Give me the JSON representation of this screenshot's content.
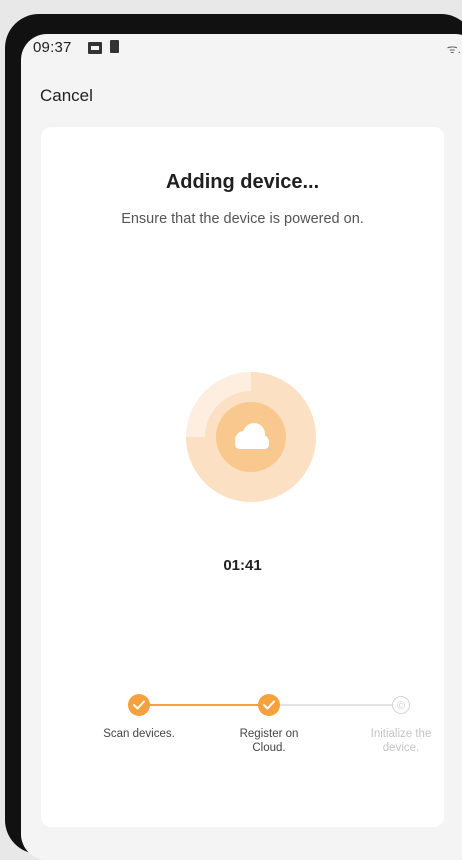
{
  "status_bar": {
    "time": "09:37",
    "right_indicators": "ᯤ.ıl"
  },
  "header": {
    "cancel_label": "Cancel"
  },
  "main": {
    "title": "Adding device...",
    "subtitle": "Ensure that the device is powered on.",
    "timer": "01:41",
    "animation_icon": "cloud-icon"
  },
  "progress_steps": [
    {
      "label": "Scan devices.",
      "state": "done"
    },
    {
      "label": "Register on Cloud.",
      "state": "done"
    },
    {
      "label": "Initialize the device.",
      "state": "pending"
    }
  ],
  "colors": {
    "accent": "#f5a23d",
    "ring_outer": "#fdeee0",
    "ring_mid": "#fbe0c3",
    "ring_inner": "#f9c88e",
    "pending": "#cfcfcf"
  }
}
